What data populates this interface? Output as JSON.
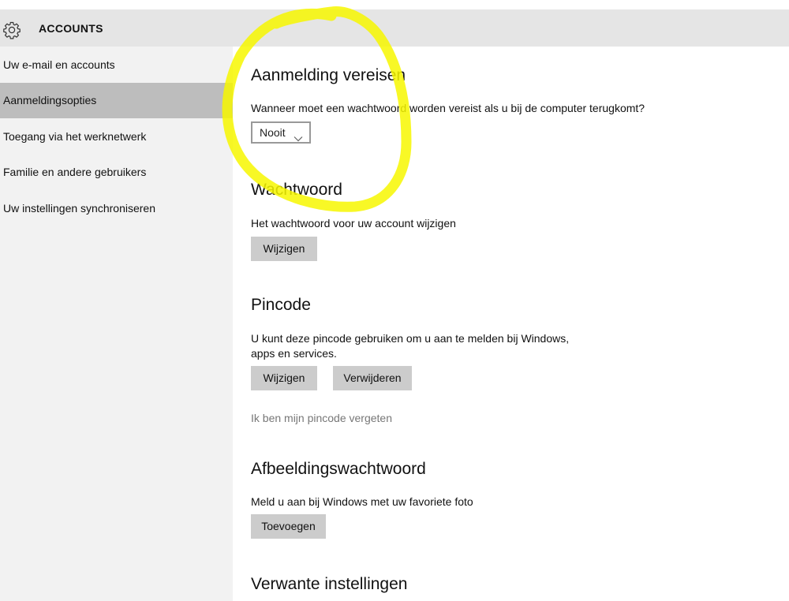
{
  "header": {
    "title": "ACCOUNTS",
    "icon": "gear-icon"
  },
  "sidebar": {
    "items": [
      {
        "label": "Uw e-mail en accounts",
        "active": false
      },
      {
        "label": "Aanmeldingsopties",
        "active": true
      },
      {
        "label": "Toegang via het werknetwerk",
        "active": false
      },
      {
        "label": "Familie en andere gebruikers",
        "active": false
      },
      {
        "label": "Uw instellingen synchroniseren",
        "active": false
      }
    ]
  },
  "sections": {
    "signin": {
      "title": "Aanmelding vereisen",
      "question": "Wanneer moet een wachtwoord worden vereist als u bij de computer terugkomt?",
      "dropdown_value": "Nooit"
    },
    "password": {
      "title": "Wachtwoord",
      "description": "Het wachtwoord voor uw account wijzigen",
      "change_button": "Wijzigen"
    },
    "pin": {
      "title": "Pincode",
      "description_line1": "U kunt deze pincode gebruiken om u aan te melden bij Windows,",
      "description_line2": "apps en services.",
      "change_button": "Wijzigen",
      "remove_button": "Verwijderen",
      "forgot_link": "Ik ben mijn pincode vergeten"
    },
    "picture_password": {
      "title": "Afbeeldingswachtwoord",
      "description": "Meld u aan bij Windows met uw favoriete foto",
      "add_button": "Toevoegen"
    },
    "related": {
      "title": "Verwante instellingen"
    }
  },
  "colors": {
    "header_bg": "#e5e5e5",
    "sidebar_bg": "#f2f2f2",
    "sidebar_active_bg": "#bdbdbd",
    "button_bg": "#cccccc",
    "annotation": "#f7f700"
  }
}
